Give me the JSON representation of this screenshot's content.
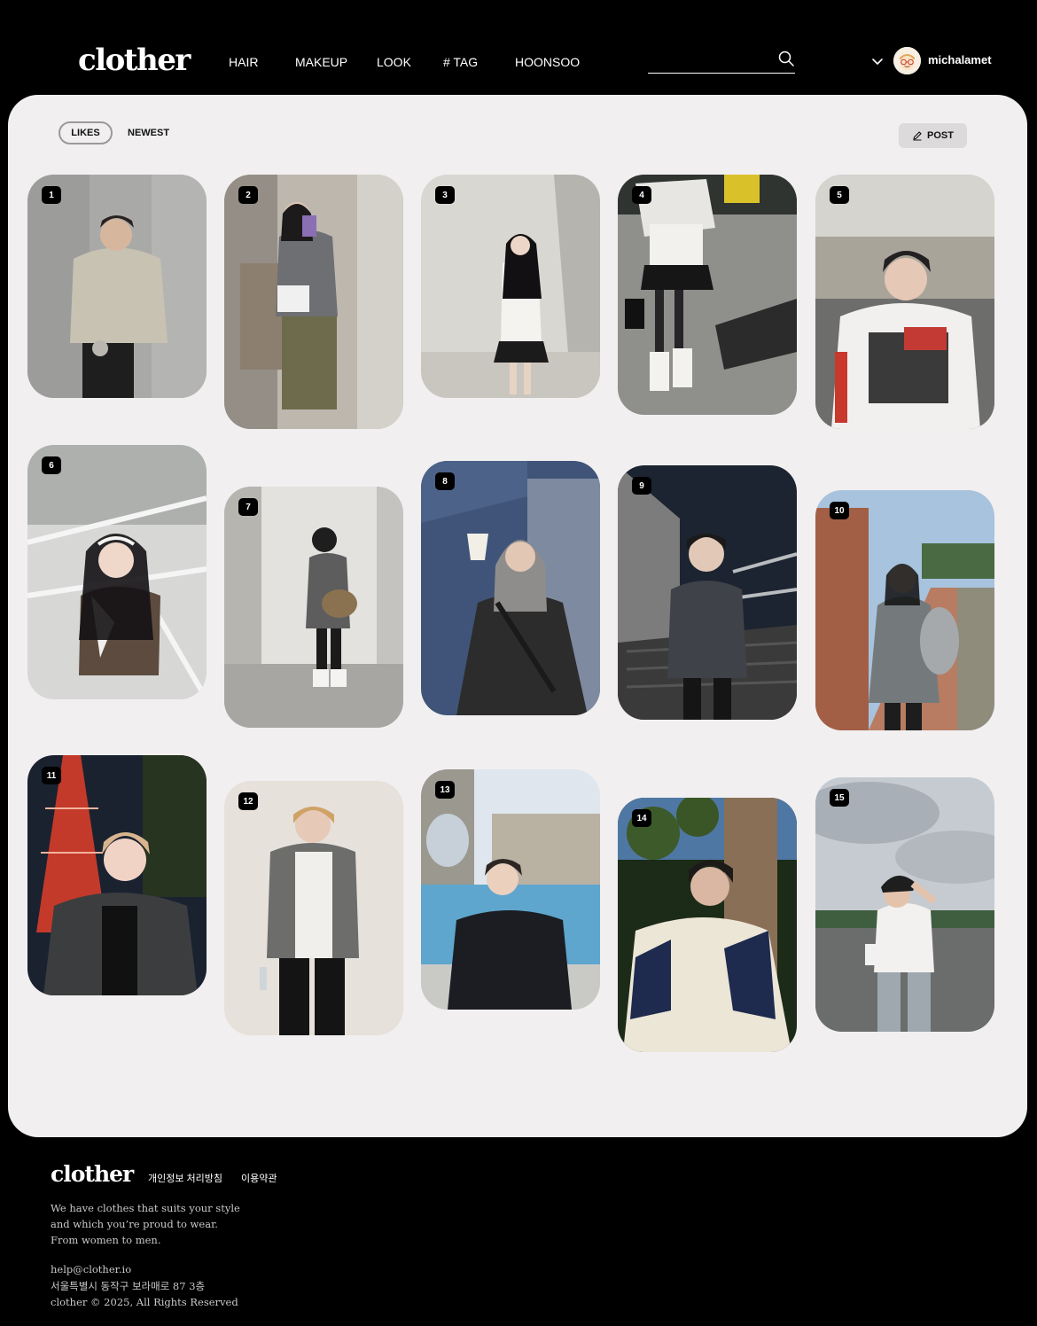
{
  "header": {
    "logo": "clother",
    "nav": [
      "HAIR",
      "MAKEUP",
      "LOOK",
      "# TAG",
      "HOONSOO"
    ],
    "search": {
      "value": "",
      "placeholder": ""
    },
    "user": {
      "name": "michalamet"
    }
  },
  "toolbar": {
    "sort_likes": "LIKES",
    "sort_newest": "NEWEST",
    "post_label": "POST"
  },
  "feed": {
    "posts": [
      {
        "rank": "1"
      },
      {
        "rank": "2"
      },
      {
        "rank": "3"
      },
      {
        "rank": "4"
      },
      {
        "rank": "5"
      },
      {
        "rank": "6"
      },
      {
        "rank": "7"
      },
      {
        "rank": "8"
      },
      {
        "rank": "9"
      },
      {
        "rank": "10"
      },
      {
        "rank": "11"
      },
      {
        "rank": "12"
      },
      {
        "rank": "13"
      },
      {
        "rank": "14"
      },
      {
        "rank": "15"
      }
    ]
  },
  "footer": {
    "logo": "clother",
    "link_privacy": "개인정보 처리방침",
    "link_terms": "이용약관",
    "tagline_1": "We have clothes that suits your style",
    "tagline_2": "and which you’re proud to wear.",
    "tagline_3": "From women to men.",
    "email": "help@clother.io",
    "address": "서울특별시 동작구 보라매로 87 3층",
    "copyright": "clother © 2025, All Rights Reserved"
  },
  "colors": {
    "background": "#000000",
    "panel": "#f1eff0",
    "badge": "#000000",
    "post_button": "#dcdadb"
  }
}
